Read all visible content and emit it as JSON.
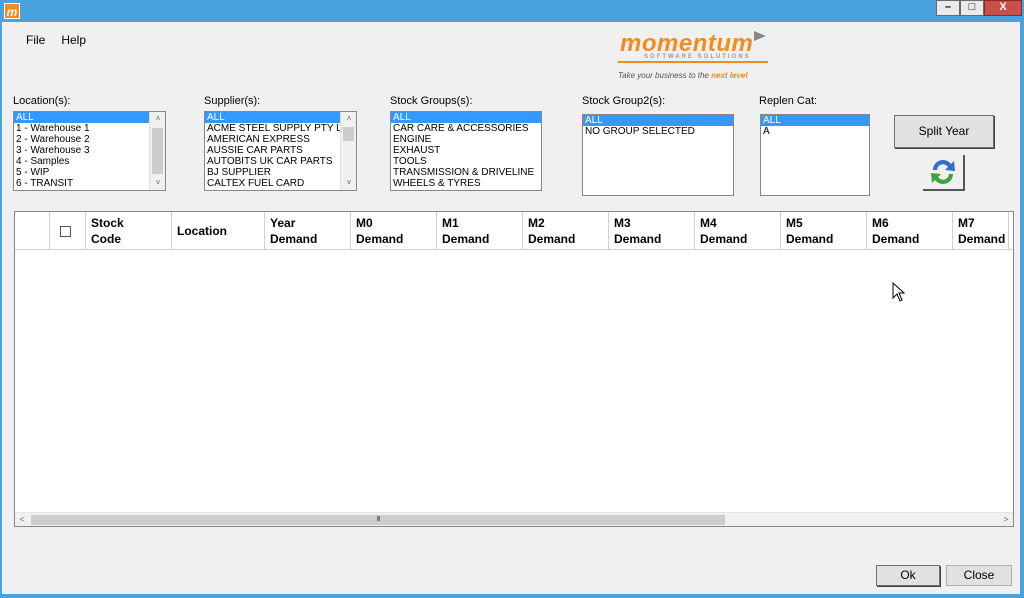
{
  "titlebar": {
    "app_icon": "m",
    "minimize": "–",
    "maximize": "□",
    "close": "X"
  },
  "menu": {
    "file": "File",
    "help": "Help"
  },
  "logo": {
    "word": "momentum",
    "subtitle": "SOFTWARE SOLUTIONS",
    "tagline_start": "Take your business to the ",
    "tagline_emphasis": "next level"
  },
  "filters": {
    "locations": {
      "label": "Location(s):",
      "items": [
        "ALL",
        "1 - Warehouse 1",
        "2 - Warehouse 2",
        "3 - Warehouse 3",
        "4 - Samples",
        "5 - WIP",
        "6 - TRANSIT"
      ],
      "selected_index": 0
    },
    "suppliers": {
      "label": "Supplier(s):",
      "items": [
        "ALL",
        "ACME STEEL SUPPLY PTY LTD",
        "AMERICAN EXPRESS",
        "AUSSIE CAR PARTS",
        "AUTOBITS UK CAR PARTS",
        "BJ SUPPLIER",
        "CALTEX FUEL CARD"
      ],
      "selected_index": 0
    },
    "stock_groups": {
      "label": "Stock Groups(s):",
      "items": [
        "ALL",
        "CAR CARE & ACCESSORIES",
        "ENGINE",
        "EXHAUST",
        "TOOLS",
        "TRANSMISSION & DRIVELINE",
        "WHEELS & TYRES"
      ],
      "selected_index": 0
    },
    "stock_group2": {
      "label": "Stock Group2(s):",
      "items": [
        "ALL",
        "NO GROUP SELECTED"
      ],
      "selected_index": 0
    },
    "replen_cat": {
      "label": "Replen Cat:",
      "items": [
        "ALL",
        "A"
      ],
      "selected_index": 0
    }
  },
  "buttons": {
    "split_year": "Split Year",
    "ok": "Ok",
    "close": "Close"
  },
  "grid": {
    "columns": [
      {
        "label": "Stock\nCode"
      },
      {
        "label": "Location"
      },
      {
        "label": "Year\nDemand"
      },
      {
        "label": "M0\nDemand"
      },
      {
        "label": "M1\nDemand"
      },
      {
        "label": "M2\nDemand"
      },
      {
        "label": "M3\nDemand"
      },
      {
        "label": "M4\nDemand"
      },
      {
        "label": "M5\nDemand"
      },
      {
        "label": "M6\nDemand"
      },
      {
        "label": "M7\nDemand"
      }
    ],
    "rows": [],
    "hscroll_grip": "III"
  },
  "colors": {
    "title_bar": "#4aa3df",
    "selection": "#3399ff",
    "brand_orange": "#f28c1e",
    "refresh_blue": "#2f6fd0",
    "refresh_green": "#3aa63a"
  },
  "icons": {
    "refresh": "refresh-icon",
    "scroll_up": "˄",
    "scroll_down": "˅",
    "scroll_left": "<",
    "scroll_right": ">"
  }
}
